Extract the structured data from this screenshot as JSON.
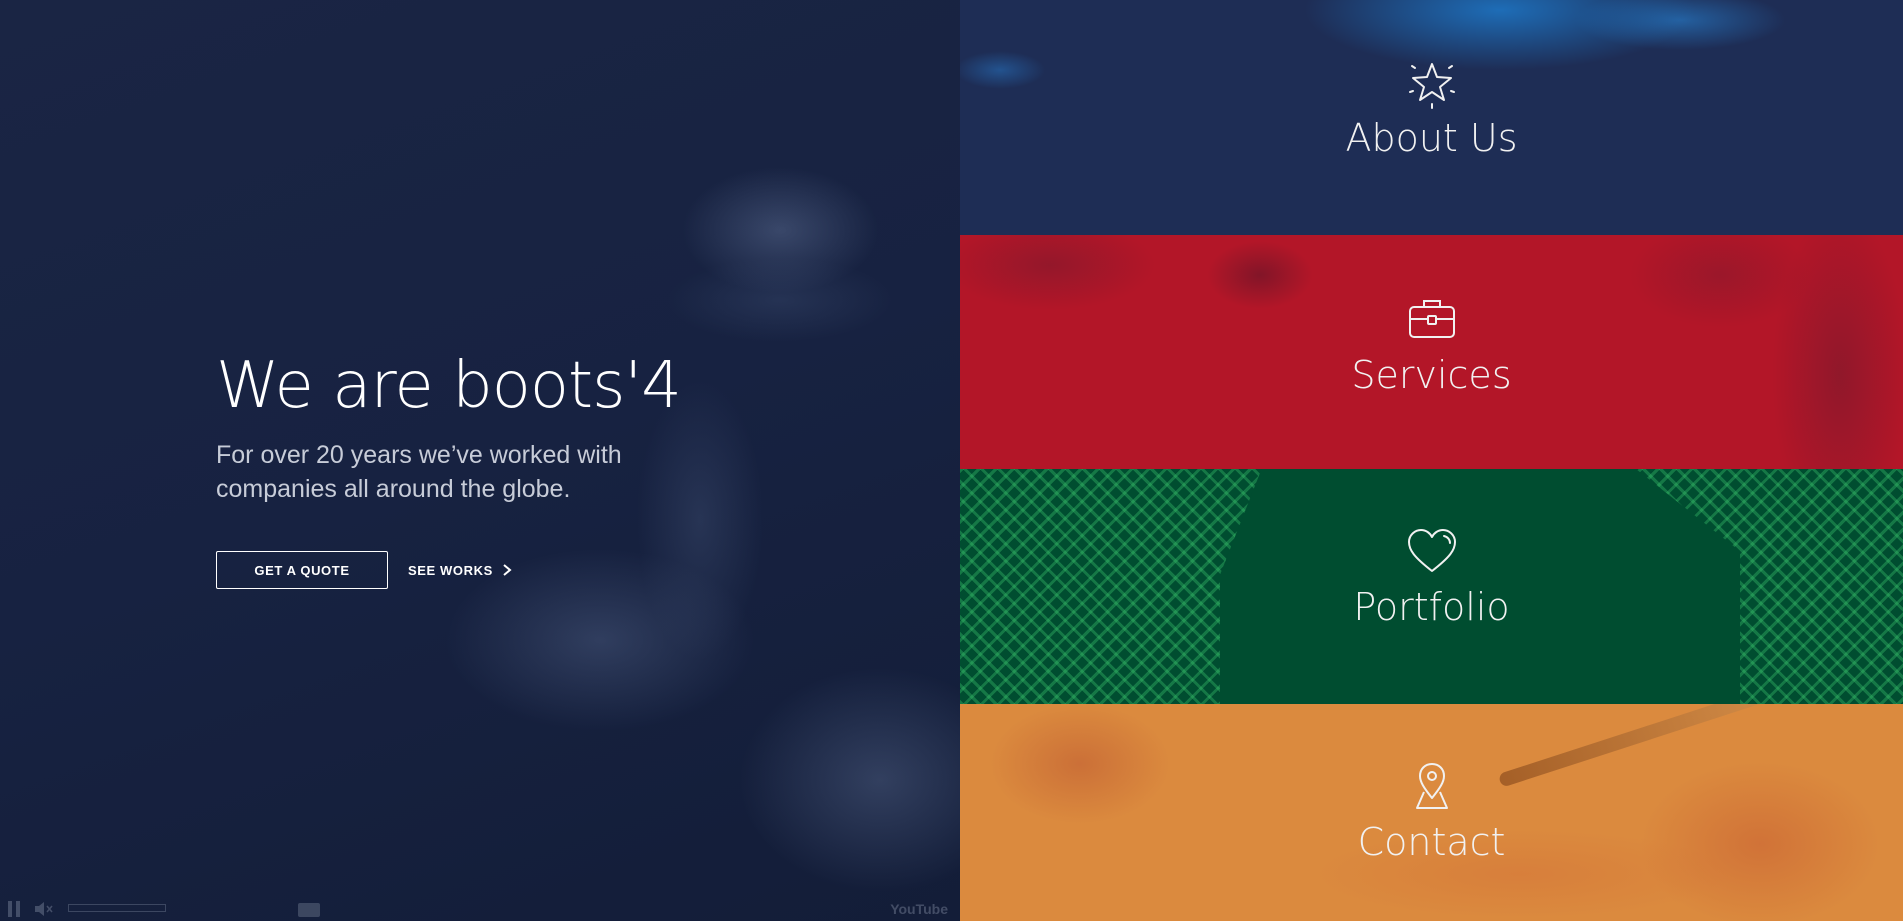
{
  "hero": {
    "title": "We are boots'4",
    "subtitle": "For over 20 years we’ve worked with companies all around the globe.",
    "quote_button": "GET A QUOTE",
    "works_link": "SEE WORKS"
  },
  "video_controls": {
    "youtube_logo": "YouTube",
    "icons": [
      "pause-icon",
      "volume-icon",
      "captions-icon",
      "youtube-logo"
    ]
  },
  "panels": [
    {
      "label": "About Us",
      "icon": "star-icon",
      "color": "#1e2d55"
    },
    {
      "label": "Services",
      "icon": "briefcase-icon",
      "color": "#b31628"
    },
    {
      "label": "Portfolio",
      "icon": "heart-icon",
      "color": "#004d30"
    },
    {
      "label": "Contact",
      "icon": "map-pin-icon",
      "color": "#db8a3e"
    }
  ]
}
